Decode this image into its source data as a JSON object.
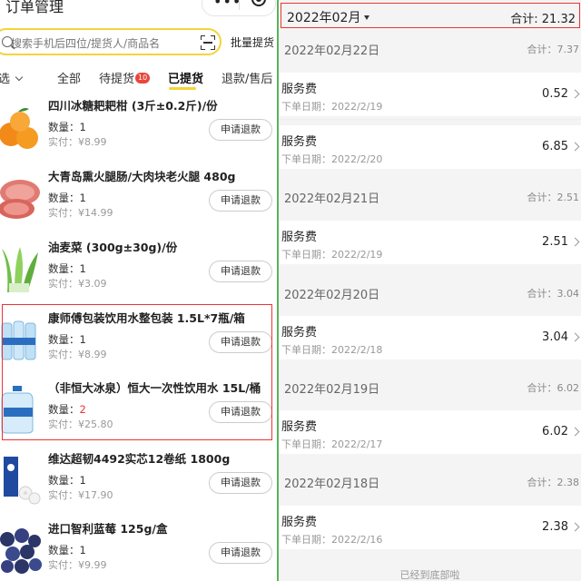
{
  "left": {
    "title": "订单管理",
    "capsule": {
      "more": "•••"
    },
    "search_placeholder": "搜索手机后四位/提货人/商品名",
    "batch_label": "批量提货",
    "tabs": [
      {
        "label": "选"
      },
      {
        "label": "全部"
      },
      {
        "label": "待提货",
        "badge": "10"
      },
      {
        "label": "已提货"
      },
      {
        "label": "退款/售后"
      }
    ],
    "items": [
      {
        "name": "四川冰糖耙耙柑 (3斤±0.2斤)/份",
        "qty_label": "数量：",
        "qty": "1",
        "paid": "实付：¥8.99",
        "refund": "申请退款",
        "thumb": "orange-thumb"
      },
      {
        "name": "大青岛熏火腿肠/大肉块老火腿 480g",
        "qty_label": "数量：",
        "qty": "1",
        "paid": "实付：¥14.99",
        "refund": "申请退款",
        "thumb": "ham-thumb"
      },
      {
        "name": "油麦菜 (300g±30g)/份",
        "qty_label": "数量：",
        "qty": "1",
        "paid": "实付：¥3.09",
        "refund": "申请退款",
        "thumb": "lettuce-thumb"
      },
      {
        "name": "康师傅包装饮用水整包装 1.5L*7瓶/箱",
        "qty_label": "数量：",
        "qty": "1",
        "paid": "实付：¥8.99",
        "refund": "申请退款",
        "thumb": "water-pack-thumb"
      },
      {
        "name": "（非恒大冰泉）恒大一次性饮用水 15L/桶",
        "qty_label": "数量：",
        "qty": "2",
        "paid": "实付：¥25.80",
        "refund": "申请退款",
        "thumb": "water-bucket-thumb"
      },
      {
        "name": "维达超韧4492实芯12卷纸 1800g",
        "qty_label": "数量：",
        "qty": "1",
        "paid": "实付：¥17.90",
        "refund": "申请退款",
        "thumb": "tissue-thumb"
      },
      {
        "name": "进口智利蓝莓 125g/盒",
        "qty_label": "数量：",
        "qty": "1",
        "paid": "实付：¥9.99",
        "refund": "申请退款",
        "thumb": "blueberry-thumb"
      }
    ]
  },
  "right": {
    "month": "2022年02月",
    "month_total": "合计: 21.32",
    "groups": [
      {
        "date": "2022年02月22日",
        "total": "合计：7.37",
        "rows": [
          {
            "title": "服务费",
            "order_date": "下单日期：2022/2/19",
            "amount": "0.52"
          },
          {
            "title": "服务费",
            "order_date": "下单日期：2022/2/20",
            "amount": "6.85"
          }
        ]
      },
      {
        "date": "2022年02月21日",
        "total": "合计：2.51",
        "rows": [
          {
            "title": "服务费",
            "order_date": "下单日期：2022/2/19",
            "amount": "2.51"
          }
        ]
      },
      {
        "date": "2022年02月20日",
        "total": "合计：3.04",
        "rows": [
          {
            "title": "服务费",
            "order_date": "下单日期：2022/2/18",
            "amount": "3.04"
          }
        ]
      },
      {
        "date": "2022年02月19日",
        "total": "合计：6.02",
        "rows": [
          {
            "title": "服务费",
            "order_date": "下单日期：2022/2/17",
            "amount": "6.02"
          }
        ]
      },
      {
        "date": "2022年02月18日",
        "total": "合计：2.38",
        "rows": [
          {
            "title": "服务费",
            "order_date": "下单日期：2022/2/16",
            "amount": "2.38"
          }
        ]
      }
    ],
    "footer": "已经到底部啦"
  },
  "colors": {
    "accent_yellow": "#f2d53a",
    "badge_red": "#e8473b",
    "highlight_red": "#e33333",
    "divider_green": "#58b35a"
  }
}
